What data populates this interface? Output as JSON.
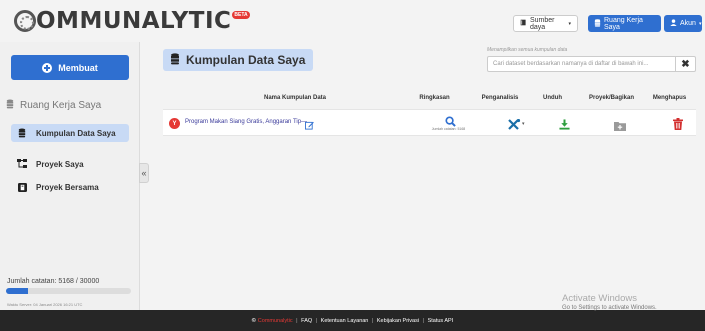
{
  "header": {
    "logo_text": "OMMUNALYTIC",
    "logo_badge": "BETA",
    "sumber_label": "Sumber daya",
    "ruang_label": "Ruang Kerja Saya",
    "akun_label": "Akun"
  },
  "sidebar": {
    "create_label": "Membuat",
    "workspace_title": "Ruang Kerja Saya",
    "items": [
      {
        "label": "Kumpulan Data Saya",
        "icon": "database-icon",
        "active": true
      },
      {
        "label": "Proyek Saya",
        "icon": "sitemap-icon",
        "active": false
      },
      {
        "label": "Proyek Bersama",
        "icon": "share-icon",
        "active": false
      }
    ],
    "record_count": "Jumlah catatan: 5168 / 30000",
    "record_used": 5168,
    "record_limit": 30000,
    "server_time": "Waktu Server: 04 Januari 2026 16:21 UTC"
  },
  "main": {
    "title": "Kumpulan Data Saya",
    "search_hint": "Menampilkan semua kumpulan data",
    "search_placeholder": "Cari dataset berdasarkan namanya di daftar di bawah ini...",
    "columns": [
      "Nama Kumpulan Data",
      "Ringkasan",
      "Penganalisis",
      "Unduh",
      "Proyek/Bagikan",
      "Menghapus"
    ],
    "rows": [
      {
        "badge": "Y",
        "name": "Program Makan Siang Gratis, Anggaran Tip—",
        "summary": "Jumlah catatan: 5168"
      }
    ]
  },
  "footer": {
    "brand": "Communalytic",
    "links": [
      "FAQ",
      "Ketentuan Layanan",
      "Kebijakan Privasi",
      "Status API"
    ]
  },
  "overlay": {
    "activate_title": "Activate Windows",
    "activate_sub": "Go to Settings to activate Windows."
  },
  "colors": {
    "primary": "#2f6fd0",
    "active_bg": "#c8daf5",
    "danger": "#e53935",
    "success": "#2e9e3e",
    "footer_bg": "#262626"
  }
}
